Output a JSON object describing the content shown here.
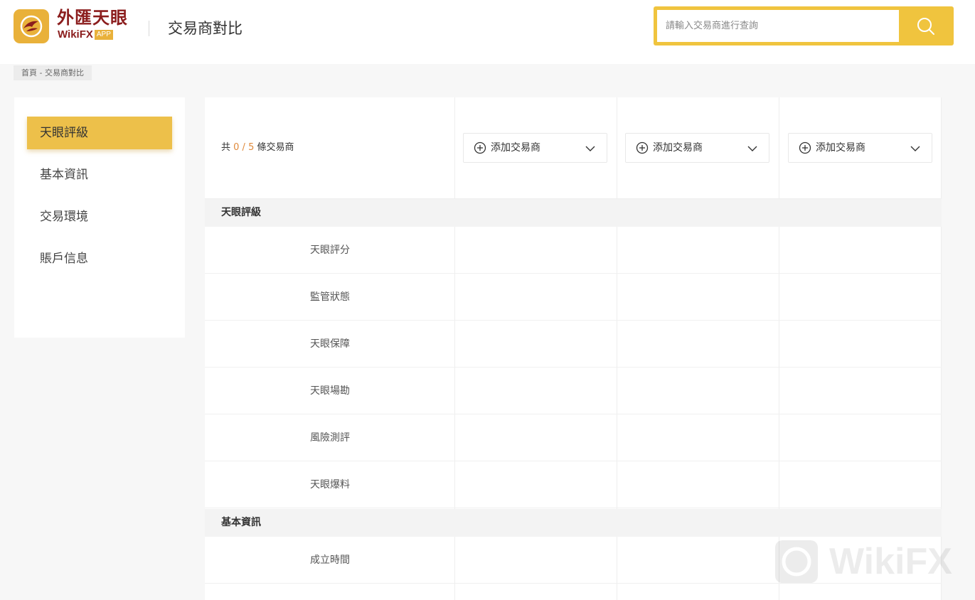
{
  "header": {
    "logo_cn": "外匯天眼",
    "logo_en": "WikiFX",
    "logo_badge": "APP",
    "title": "交易商對比"
  },
  "search": {
    "placeholder": "請輸入交易商進行查詢"
  },
  "breadcrumb": {
    "home": "首頁",
    "separator": " - ",
    "current": "交易商對比"
  },
  "sidebar": {
    "items": [
      {
        "label": "天眼評級",
        "active": true
      },
      {
        "label": "基本資訊",
        "active": false
      },
      {
        "label": "交易環境",
        "active": false
      },
      {
        "label": "賬戶信息",
        "active": false
      }
    ]
  },
  "compare": {
    "count_prefix": "共 ",
    "count_current": "0",
    "count_sep": " / ",
    "count_max": "5",
    "count_suffix": " 條交易商",
    "add_buttons": [
      {
        "label": "添加交易商"
      },
      {
        "label": "添加交易商"
      },
      {
        "label": "添加交易商"
      }
    ]
  },
  "sections": [
    {
      "title": "天眼評級",
      "rows": [
        {
          "label": "天眼評分"
        },
        {
          "label": "監管狀態"
        },
        {
          "label": "天眼保障"
        },
        {
          "label": "天眼場勘"
        },
        {
          "label": "風險測評"
        },
        {
          "label": "天眼爆料"
        }
      ]
    },
    {
      "title": "基本資訊",
      "rows": [
        {
          "label": "成立時間"
        }
      ]
    }
  ],
  "watermark": "WikiFX",
  "colors": {
    "accent": "#edc04a",
    "search_border": "#f0c43e",
    "brand_red": "#8b1d1d",
    "count_highlight": "#e08a3c"
  },
  "icons": {
    "search": "search-icon",
    "add": "plus-circle-icon",
    "dropdown": "chevron-down-icon",
    "logo": "eagle-logo-icon"
  }
}
